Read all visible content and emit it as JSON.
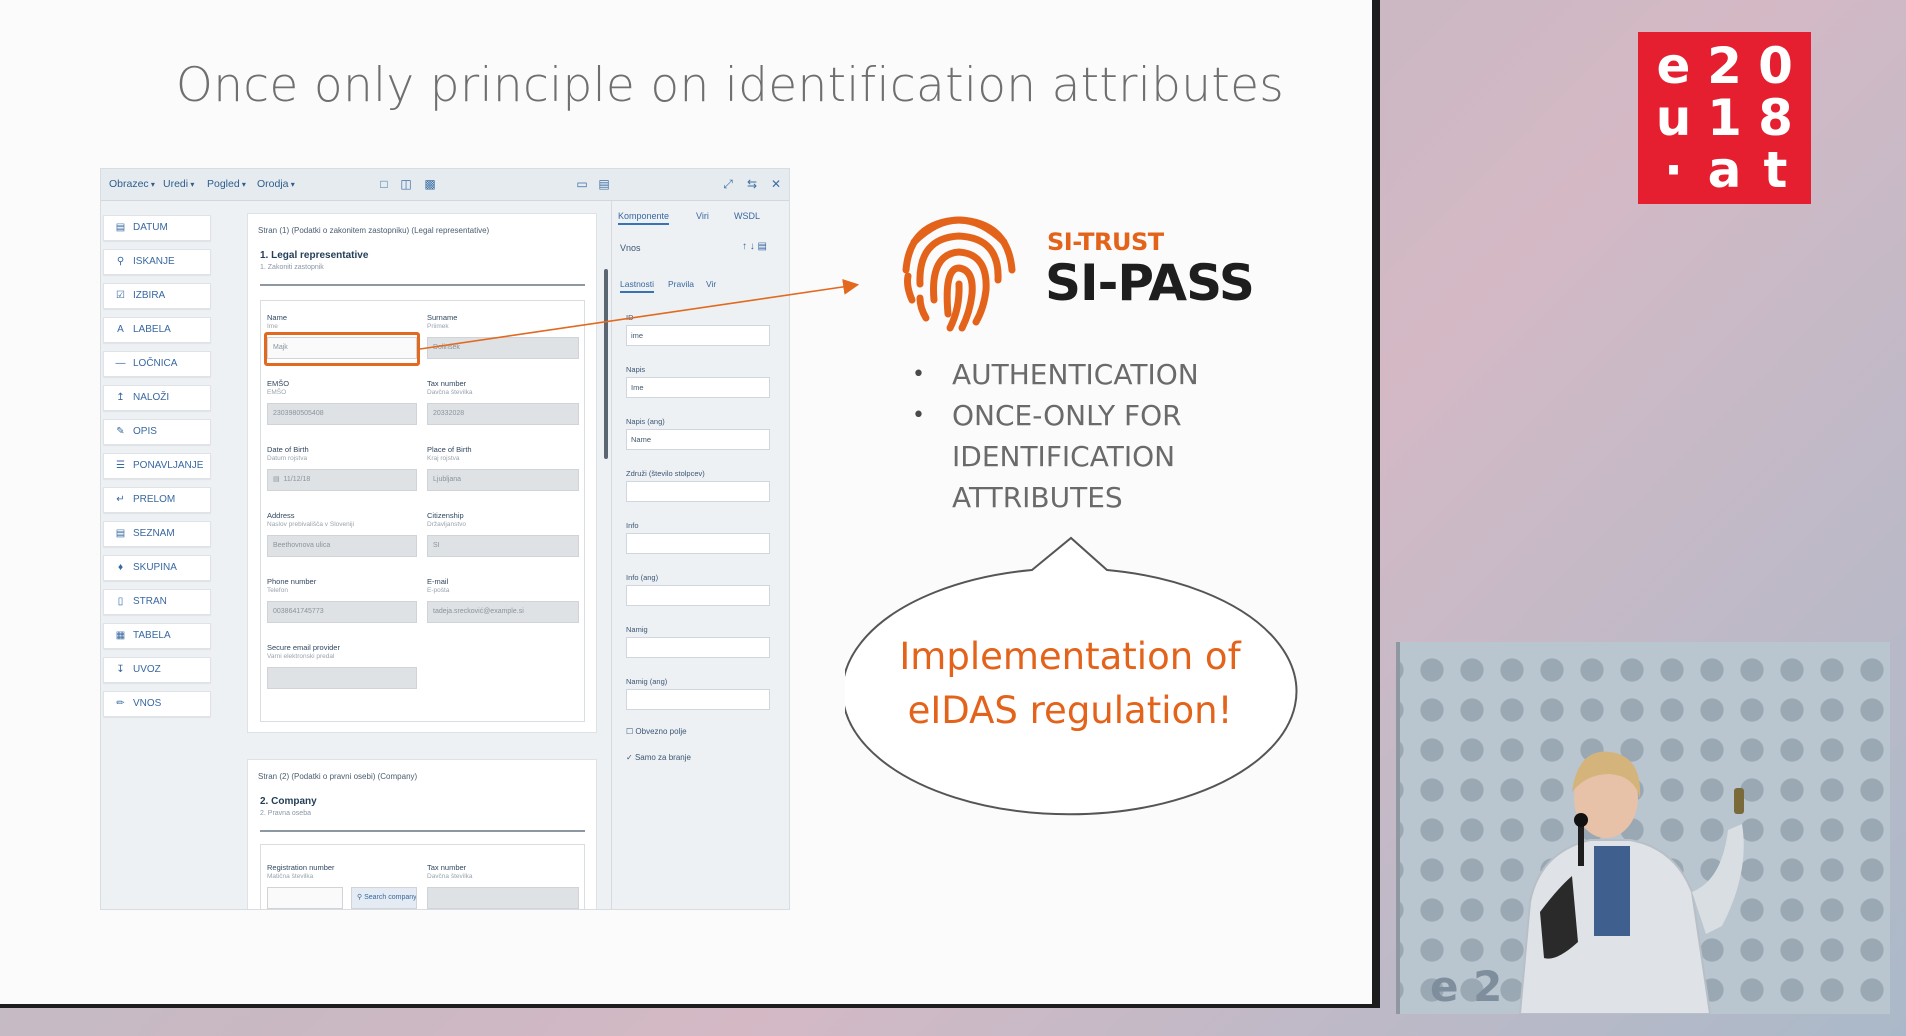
{
  "slide": {
    "title": "Once only principle on identification attributes"
  },
  "app": {
    "menu": [
      "Obrazec",
      "Uredi",
      "Pogled",
      "Orodja"
    ],
    "sidebar": [
      {
        "label": "DATUM",
        "icon": "calendar-icon"
      },
      {
        "label": "ISKANJE",
        "icon": "search-icon"
      },
      {
        "label": "IZBIRA",
        "icon": "checkbox-icon"
      },
      {
        "label": "LABELA",
        "icon": "label-icon"
      },
      {
        "label": "LOČNICA",
        "icon": "divider-icon"
      },
      {
        "label": "NALOŽI",
        "icon": "upload-icon"
      },
      {
        "label": "OPIS",
        "icon": "edit-icon"
      },
      {
        "label": "PONAVLJANJE",
        "icon": "repeat-icon"
      },
      {
        "label": "PRELOM",
        "icon": "break-icon"
      },
      {
        "label": "SEZNAM",
        "icon": "list-icon"
      },
      {
        "label": "SKUPINA",
        "icon": "group-icon"
      },
      {
        "label": "STRAN",
        "icon": "page-icon"
      },
      {
        "label": "TABELA",
        "icon": "table-icon"
      },
      {
        "label": "UVOZ",
        "icon": "import-icon"
      },
      {
        "label": "VNOS",
        "icon": "pencil-icon"
      }
    ],
    "section1": {
      "path": "Stran (1) (Podatki o zakonitem zastopniku) (Legal representative)",
      "title": "1. Legal representative",
      "subtitle": "1. Zakoniti zastopnik",
      "fields": {
        "name_label": "Name",
        "name_hint": "Ime",
        "name_value": "Majk",
        "surname_label": "Surname",
        "surname_hint": "Priimek",
        "surname_value": "Dolinšek",
        "emso_label": "EMŠO",
        "emso_hint": "EMŠO",
        "emso_value": "2303980505408",
        "tax_label": "Tax number",
        "tax_hint": "Davčna številka",
        "tax_value": "20332028",
        "dob_label": "Date of Birth",
        "dob_hint": "Datum rojstva",
        "dob_value": "11/12/18",
        "pob_label": "Place of Birth",
        "pob_hint": "Kraj rojstva",
        "pob_value": "Ljubljana",
        "address_label": "Address",
        "address_hint": "Naslov prebivališča v Sloveniji",
        "address_value": "Beethovnova ulica",
        "citizenship_label": "Citizenship",
        "citizenship_hint": "Državljanstvo",
        "citizenship_value": "SI",
        "phone_label": "Phone number",
        "phone_hint": "Telefon",
        "phone_value": "0038641745773",
        "email_label": "E-mail",
        "email_hint": "E-pošta",
        "email_value": "tadeja.srecković@example.si",
        "secure_label": "Secure email provider",
        "secure_hint": "Varni elektronski predal"
      }
    },
    "section2": {
      "path": "Stran (2) (Podatki o pravni osebi) (Company)",
      "title": "2. Company",
      "subtitle": "2. Pravna oseba",
      "reg_label": "Registration number",
      "reg_hint": "Matična številka",
      "tax_label": "Tax number",
      "tax_hint": "Davčna številka",
      "search_button": "Search company"
    },
    "props": {
      "tabs": [
        "Komponente",
        "Viri",
        "WSDL"
      ],
      "vnos_label": "Vnos",
      "subtabs": [
        "Lastnosti",
        "Pravila",
        "Vir"
      ],
      "id_label": "ID",
      "id_value": "ime",
      "napis_label": "Napis",
      "napis_value": "Ime",
      "napis_ang_label": "Napis (ang)",
      "napis_ang_value": "Name",
      "zdruzi_label": "Združi (število stolpcev)",
      "info_label": "Info",
      "info_ang_label": "Info (ang)",
      "namig_label": "Namig",
      "namig_ang_label": "Namig (ang)",
      "obvezno_label": "Obvezno polje",
      "samo_label": "Samo za branje"
    }
  },
  "brand": {
    "sitrust": "SI-TRUST",
    "sipass": "SI-PASS",
    "accent_color": "#e4631b"
  },
  "bullets": [
    "AUTHENTICATION",
    "ONCE-ONLY FOR IDENTIFICATION ATTRIBUTES"
  ],
  "bubble": {
    "line1": "Implementation of",
    "line2": "eIDAS regulation!"
  },
  "event_logo": {
    "cells": [
      "e",
      "2",
      "0",
      "u",
      "1",
      "8",
      "·",
      "a",
      "t"
    ],
    "color": "#e51f2f"
  },
  "camera": {
    "wall_text": "e 2"
  }
}
